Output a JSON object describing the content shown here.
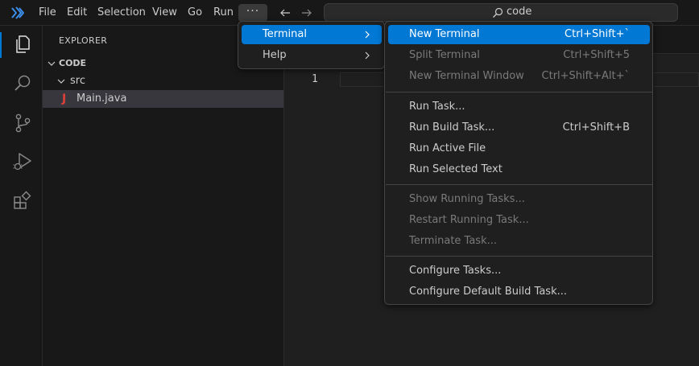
{
  "titlebar": {
    "menus": [
      "File",
      "Edit",
      "Selection",
      "View",
      "Go",
      "Run"
    ],
    "more_label": "···",
    "search_text": "code"
  },
  "sidebar": {
    "title": "EXPLORER",
    "root_folder": "CODE",
    "subfolder": "src",
    "file_icon_glyph": "J",
    "file_name": "Main.java"
  },
  "editor": {
    "line_number": "1"
  },
  "view_menu": {
    "items": [
      {
        "label": "Terminal"
      },
      {
        "label": "Help"
      }
    ]
  },
  "terminal_menu": {
    "items": [
      {
        "label": "New Terminal",
        "shortcut": "Ctrl+Shift+`"
      },
      {
        "label": "Split Terminal",
        "shortcut": "Ctrl+Shift+5"
      },
      {
        "label": "New Terminal Window",
        "shortcut": "Ctrl+Shift+Alt+`"
      },
      {
        "label": "Run Task..."
      },
      {
        "label": "Run Build Task...",
        "shortcut": "Ctrl+Shift+B"
      },
      {
        "label": "Run Active File"
      },
      {
        "label": "Run Selected Text"
      },
      {
        "label": "Show Running Tasks..."
      },
      {
        "label": "Restart Running Task..."
      },
      {
        "label": "Terminate Task..."
      },
      {
        "label": "Configure Tasks..."
      },
      {
        "label": "Configure Default Build Task..."
      }
    ]
  },
  "colors": {
    "accent": "#0078d4",
    "java_icon": "#e0403a",
    "disabled_text": "#7a7a7a"
  },
  "icons": [
    "vscode-logo-icon",
    "back-arrow-icon",
    "forward-arrow-icon",
    "search-icon",
    "explorer-icon",
    "search-view-icon",
    "source-control-icon",
    "run-debug-icon",
    "extensions-icon",
    "chevron-down-icon",
    "chevron-right-icon",
    "java-file-icon"
  ]
}
